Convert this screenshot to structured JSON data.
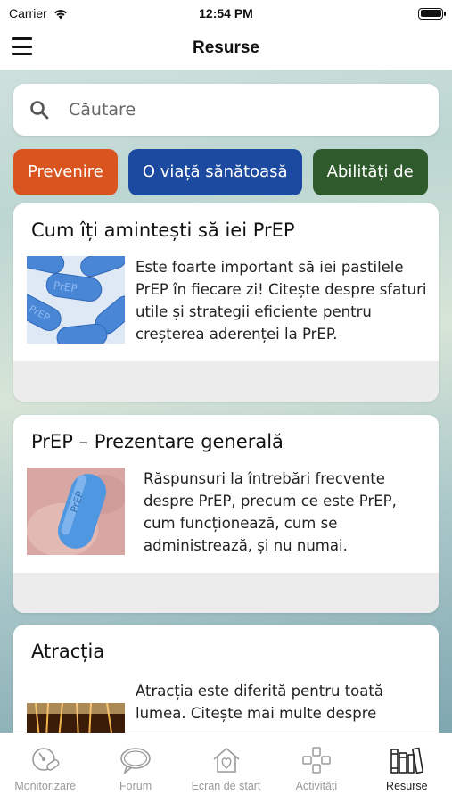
{
  "status_bar": {
    "carrier": "Carrier",
    "time": "12:54 PM"
  },
  "header": {
    "title": "Resurse"
  },
  "search": {
    "placeholder": "Căutare"
  },
  "categories": [
    {
      "label": "Prevenire",
      "color": "#d9541f"
    },
    {
      "label": "O viață sănătoasă",
      "color": "#1b4aa0"
    },
    {
      "label": "Abilități de",
      "color": "#2f5a2c"
    }
  ],
  "articles": [
    {
      "title": "Cum îți amintești să iei PrEP",
      "description": "Este foarte important să iei pastilele PrEP în fiecare zi! Citește despre sfaturi utile și strategii eficiente pentru creșterea aderenței la PrEP.",
      "image": "prep-pills-image"
    },
    {
      "title": "PrEP – Prezentare generală",
      "description": "Răspunsuri la întrebări frecvente despre PrEP, precum ce este PrEP, cum funcționează, cum se administrează, și nu numai.",
      "image": "prep-pill-in-hand-image"
    },
    {
      "title": "Atracția",
      "description": "Atracția este diferită pentru toată lumea. Citește mai multe despre",
      "image": "sparkle-image"
    }
  ],
  "tab_bar": [
    {
      "label": "Monitorizare",
      "icon": "monitor-icon",
      "active": false
    },
    {
      "label": "Forum",
      "icon": "chat-bubble-icon",
      "active": false
    },
    {
      "label": "Ecran de start",
      "icon": "home-heart-icon",
      "active": false
    },
    {
      "label": "Activități",
      "icon": "gamepad-icon",
      "active": false
    },
    {
      "label": "Resurse",
      "icon": "books-icon",
      "active": true
    }
  ]
}
